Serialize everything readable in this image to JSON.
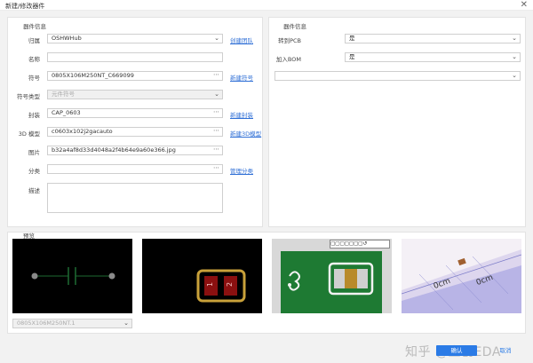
{
  "window": {
    "title": "新建/修改器件",
    "close_glyph": "✕"
  },
  "left_panel": {
    "title": "器件信息",
    "rows": {
      "owner": {
        "label": "归属",
        "value": "OSHWHub",
        "link": "创建团队"
      },
      "name": {
        "label": "名称",
        "value": ""
      },
      "symbol": {
        "label": "符号",
        "value": "0805X106M250NT_C669099",
        "link": "新建符号"
      },
      "symbol_type": {
        "label": "符号类型",
        "value": "元件符号"
      },
      "footprint": {
        "label": "封装",
        "value": "CAP_0603",
        "link": "新建封装"
      },
      "model3d": {
        "label": "3D 模型",
        "value": "c0603x102j2gacauto",
        "link": "新建3D模型"
      },
      "image": {
        "label": "图片",
        "value": "b32a4af8d33d4048a2f4b64e9a60e366.jpg"
      },
      "category": {
        "label": "分类",
        "value": "",
        "link": "管理分类"
      },
      "description": {
        "label": "描述",
        "value": ""
      }
    }
  },
  "right_panel": {
    "title": "器件信息",
    "rows": {
      "to_pcb": {
        "label": "转到PCB",
        "value": "是"
      },
      "add_bom": {
        "label": "加入BOM",
        "value": "是"
      },
      "extra": {
        "value": ""
      }
    }
  },
  "preview": {
    "title": "预览",
    "select_value": "0805X106M250NT.1",
    "pad_labels": [
      "1",
      "2"
    ],
    "ruler_labels": [
      "0cm",
      "0cm"
    ]
  },
  "buttons": {
    "ok": "确认",
    "cancel": "取消"
  },
  "watermark": "知乎 @立创EDA",
  "colors": {
    "accent": "#2b7be6",
    "link": "#2f6fd6",
    "pcb_green": "#1e7a33",
    "pad_red": "#8b1010",
    "pad_gold": "#c9a13a"
  }
}
